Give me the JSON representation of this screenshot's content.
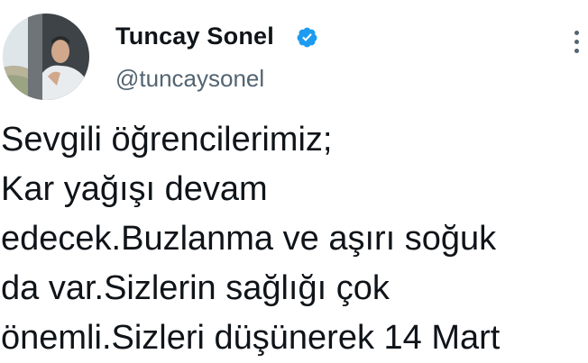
{
  "author": {
    "display_name": "Tuncay Sonel",
    "handle": "@tuncaysonel",
    "verified": true,
    "verified_color": "#1d9bf0"
  },
  "icons": {
    "verified": "verified-badge-icon",
    "more": "more-options-icon"
  },
  "tweet": {
    "lines": [
      "Sevgili öğrencilerimiz;",
      "Kar yağışı devam",
      "edecek.Buzlanma ve aşırı soğuk",
      "da var.Sizlerin sağlığı çok",
      "önemli.Sizleri düşünerek 14 Mart"
    ]
  }
}
